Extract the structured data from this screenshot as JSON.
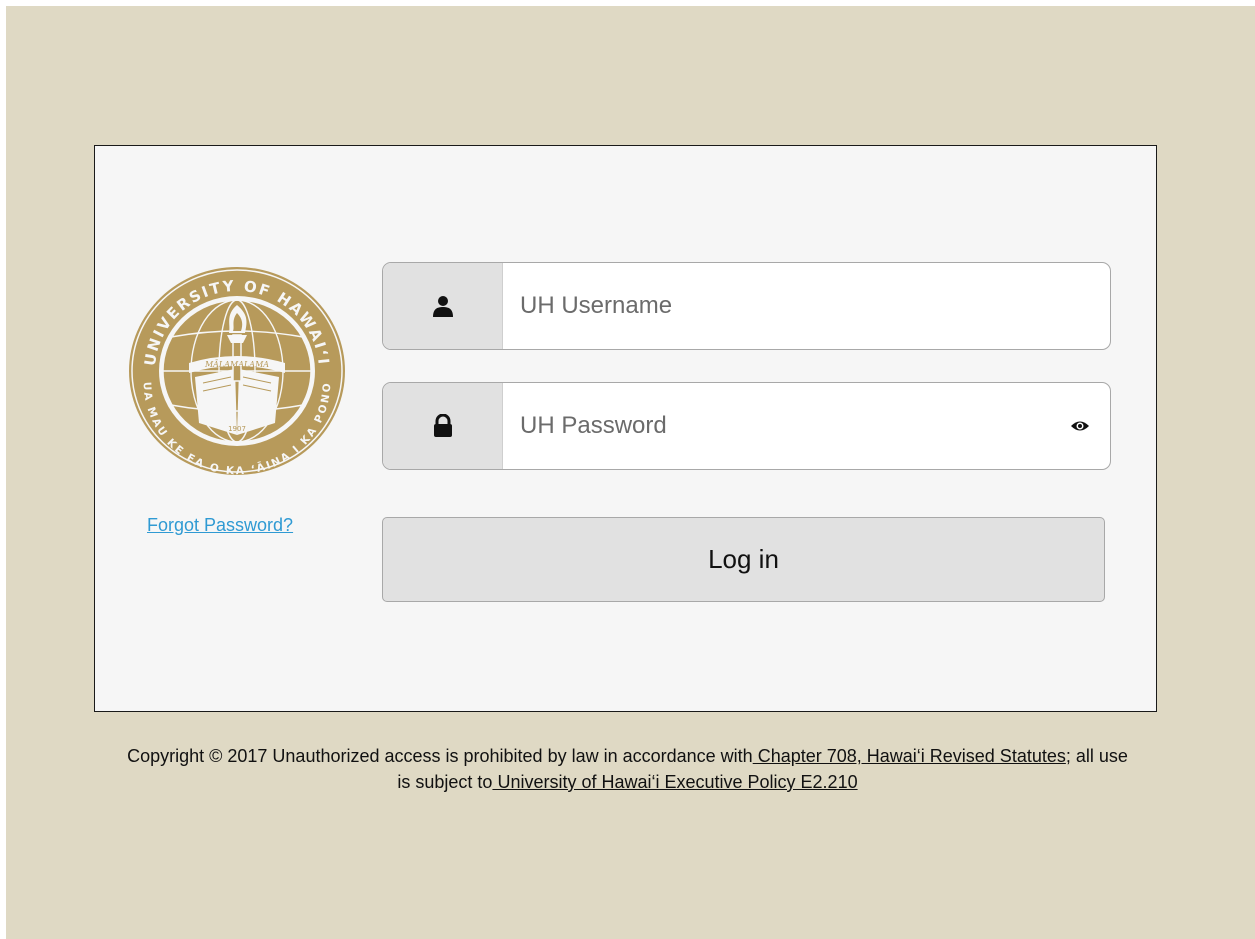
{
  "seal": {
    "top_text": "UNIVERSITY OF HAWAI‘I",
    "bottom_text": "UA MAU KE EA O KA ‘ĀINA I KA PONO",
    "banner_text": "MĀLAMALAMA",
    "year": "1907",
    "colors": {
      "gold": "#b79a5b",
      "light": "#f6f6f6"
    }
  },
  "forgot_link": "Forgot Password?",
  "username": {
    "placeholder": "UH Username",
    "icon": "user-icon"
  },
  "password": {
    "placeholder": "UH Password",
    "icon": "lock-icon",
    "toggle_icon": "eye-icon"
  },
  "login_button": "Log in",
  "footer": {
    "text_1": "Copyright © 2017 Unauthorized access is prohibited by law in accordance with",
    "link_1": " Chapter 708, Hawai‘i Revised Statutes",
    "text_2": "; all use is subject to",
    "link_2": " University of Hawai‘i Executive Policy E2.210"
  },
  "colors": {
    "background": "#dfd9c4",
    "panel": "#f6f6f6",
    "link": "#2f9ad3",
    "addon": "#e1e1e1"
  }
}
